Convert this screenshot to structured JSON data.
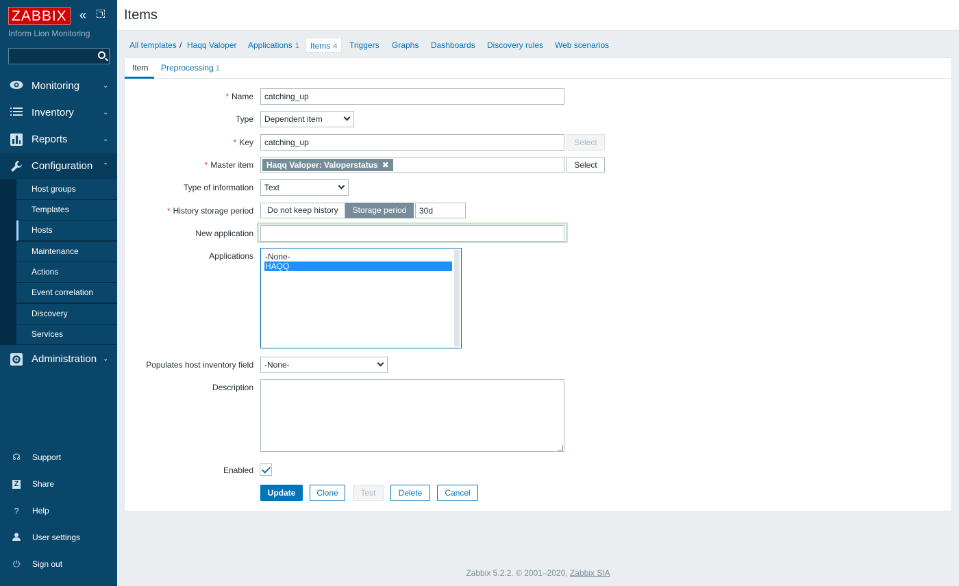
{
  "sidebar": {
    "logo": "ZABBIX",
    "server_name": "Inform Lion Monitoring",
    "search_placeholder": "",
    "menu": [
      {
        "label": "Monitoring",
        "icon": "eye-icon"
      },
      {
        "label": "Inventory",
        "icon": "list-icon"
      },
      {
        "label": "Reports",
        "icon": "bar-chart-icon"
      },
      {
        "label": "Configuration",
        "icon": "wrench-icon"
      },
      {
        "label": "Administration",
        "icon": "gear-icon"
      }
    ],
    "config_submenu": [
      "Host groups",
      "Templates",
      "Hosts",
      "Maintenance",
      "Actions",
      "Event correlation",
      "Discovery",
      "Services"
    ],
    "active_submenu": "Hosts",
    "bottom": [
      {
        "label": "Support",
        "icon": "headset-icon"
      },
      {
        "label": "Share",
        "icon": "share-z-icon"
      },
      {
        "label": "Help",
        "icon": "question-icon"
      },
      {
        "label": "User settings",
        "icon": "user-icon"
      },
      {
        "label": "Sign out",
        "icon": "power-icon"
      }
    ]
  },
  "header": {
    "title": "Items"
  },
  "crumbs": {
    "all_templates": "All templates",
    "separator": "/",
    "template": "Haqq Valoper",
    "applications": "Applications",
    "applications_count": "1",
    "items": "Items",
    "items_count": "4",
    "triggers": "Triggers",
    "graphs": "Graphs",
    "dashboards": "Dashboards",
    "discovery_rules": "Discovery rules",
    "web_scenarios": "Web scenarios"
  },
  "subtabs": {
    "item": "Item",
    "preprocessing": "Preprocessing",
    "preprocessing_count": "1"
  },
  "form": {
    "name_label": "Name",
    "name_value": "catching_up",
    "type_label": "Type",
    "type_value": "Dependent item",
    "key_label": "Key",
    "key_value": "catching_up",
    "key_select": "Select",
    "master_label": "Master item",
    "master_value": "Haqq Valoper: Valoperstatus",
    "master_select": "Select",
    "type_info_label": "Type of information",
    "type_info_value": "Text",
    "history_label": "History storage period",
    "history_opt1": "Do not keep history",
    "history_opt2": "Storage period",
    "history_value": "30d",
    "new_app_label": "New application",
    "new_app_value": "",
    "applications_label": "Applications",
    "applications_options": [
      "-None-",
      "HAQQ"
    ],
    "inventory_label": "Populates host inventory field",
    "inventory_value": "-None-",
    "description_label": "Description",
    "description_value": "",
    "enabled_label": "Enabled",
    "enabled": true
  },
  "buttons": {
    "update": "Update",
    "clone": "Clone",
    "test": "Test",
    "delete": "Delete",
    "cancel": "Cancel"
  },
  "footer": {
    "text": "Zabbix 5.2.2. © 2001–2020,",
    "link": "Zabbix SIA"
  },
  "colors": {
    "sidebar": "#0a466a",
    "accent": "#0275b8",
    "logo": "#d40000",
    "required": "#e33734"
  }
}
